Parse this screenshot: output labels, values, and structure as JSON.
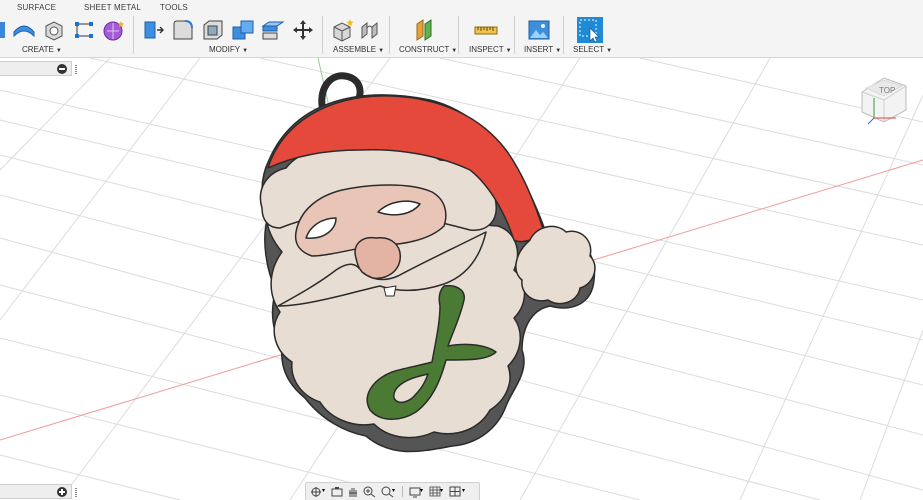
{
  "ribbon": {
    "tabs": [
      "SURFACE",
      "SHEET METAL",
      "TOOLS"
    ],
    "groups": {
      "create": "CREATE",
      "modify": "MODIFY",
      "assemble": "ASSEMBLE",
      "construct": "CONSTRUCT",
      "inspect": "INSPECT",
      "insert": "INSERT",
      "select": "SELECT"
    }
  },
  "viewcube": {
    "face_label": "TOP"
  },
  "colors": {
    "hat_red": "#e4493b",
    "beard": "#e8ddd3",
    "face_pink": "#e9c5b8",
    "letter_green": "#4b7a34",
    "outline": "#2b2b2b",
    "select_blue": "#1f8ad6",
    "grid": "#dcdcdc"
  }
}
